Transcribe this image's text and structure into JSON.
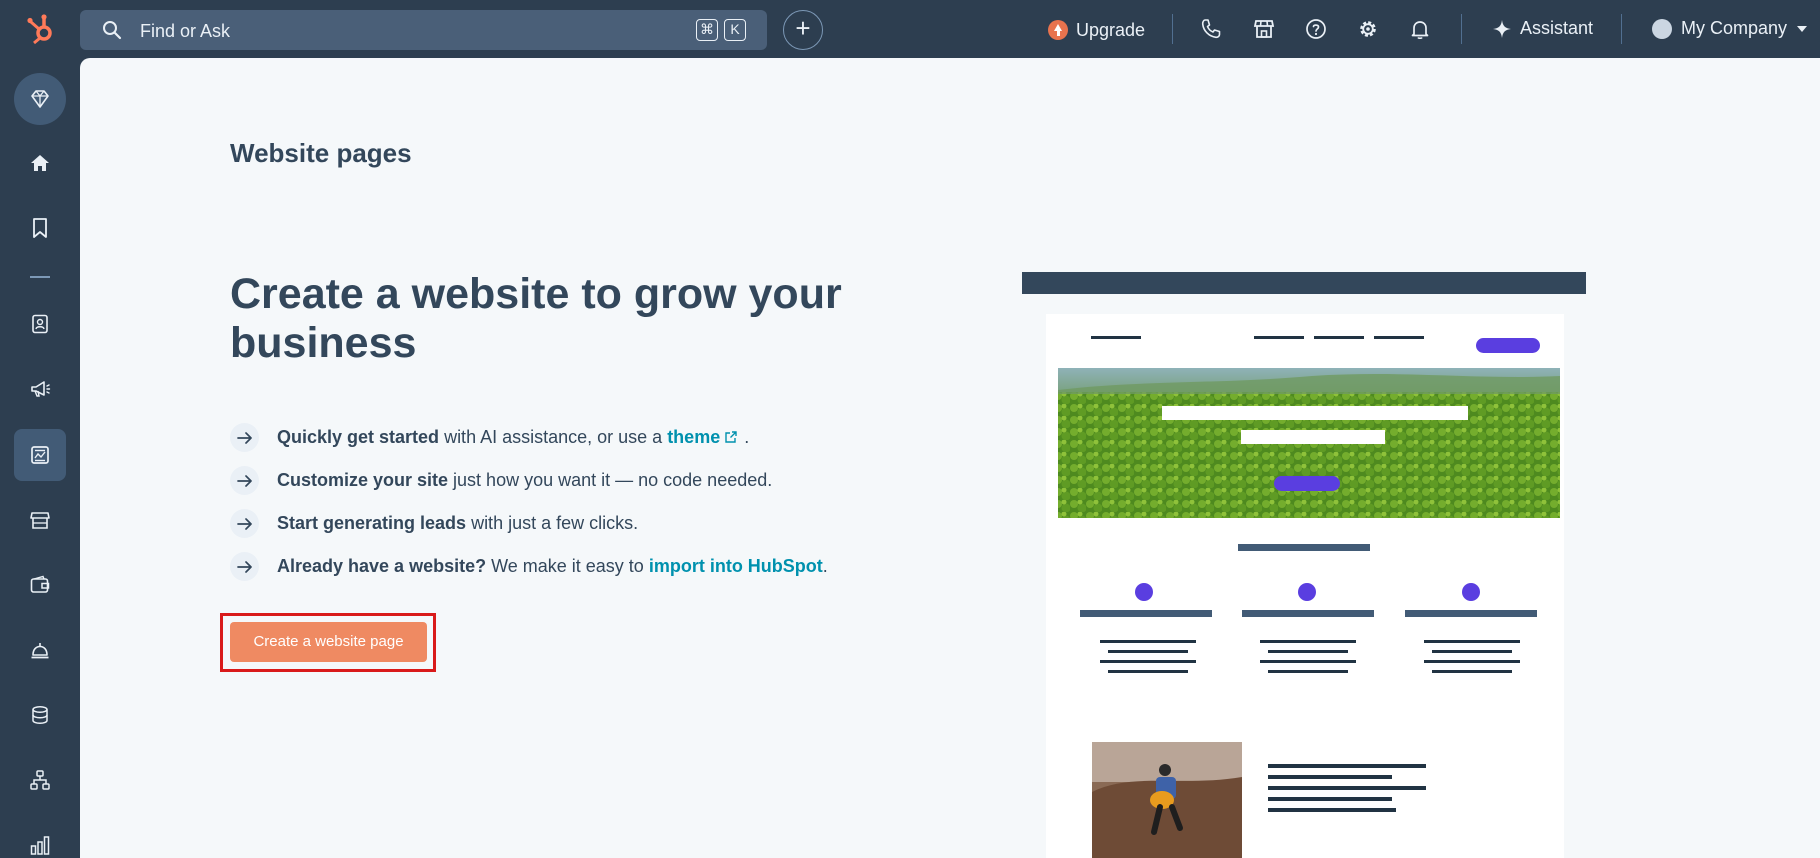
{
  "topbar": {
    "search_placeholder": "Find or Ask",
    "shortcut_keys": [
      "⌘",
      "K"
    ],
    "add_label": "+",
    "upgrade_label": "Upgrade",
    "assistant_label": "Assistant",
    "account_label": "My Company",
    "icons": [
      "phone-icon",
      "marketplace-icon",
      "help-icon",
      "settings-icon",
      "notifications-icon"
    ]
  },
  "sidebar": {
    "items": [
      {
        "name": "upgrade-gem-icon",
        "active": false
      },
      {
        "name": "home-icon",
        "active": false
      },
      {
        "name": "bookmarks-icon",
        "active": false
      },
      {
        "name": "contacts-icon",
        "active": false
      },
      {
        "name": "marketing-icon",
        "active": false
      },
      {
        "name": "content-icon",
        "active": true
      },
      {
        "name": "commerce-icon",
        "active": false
      },
      {
        "name": "payments-icon",
        "active": false
      },
      {
        "name": "service-icon",
        "active": false
      },
      {
        "name": "data-icon",
        "active": false
      },
      {
        "name": "automation-icon",
        "active": false
      },
      {
        "name": "reporting-icon",
        "active": false
      }
    ]
  },
  "main": {
    "page_title": "Website pages",
    "headline": "Create a website to grow your business",
    "features": [
      {
        "bold": "Quickly get started",
        "text": " with AI assistance, or use a ",
        "link": "theme",
        "after": "."
      },
      {
        "bold": "Customize your site",
        "text": " just how you want it — no code needed.",
        "link": "",
        "after": ""
      },
      {
        "bold": "Start generating leads",
        "text": " with just a few clicks.",
        "link": "",
        "after": ""
      },
      {
        "bold": "Already have a website?",
        "text": " We make it easy to ",
        "link": "import into HubSpot",
        "after": "."
      }
    ],
    "cta_label": "Create a website page"
  },
  "colors": {
    "nav_bg": "#2d3e50",
    "page_bg": "#f5f8fa",
    "text": "#33475b",
    "link": "#0091ae",
    "cta": "#ef8a62",
    "highlight": "#d91a1a",
    "illustration_accent": "#5a3ee0"
  }
}
